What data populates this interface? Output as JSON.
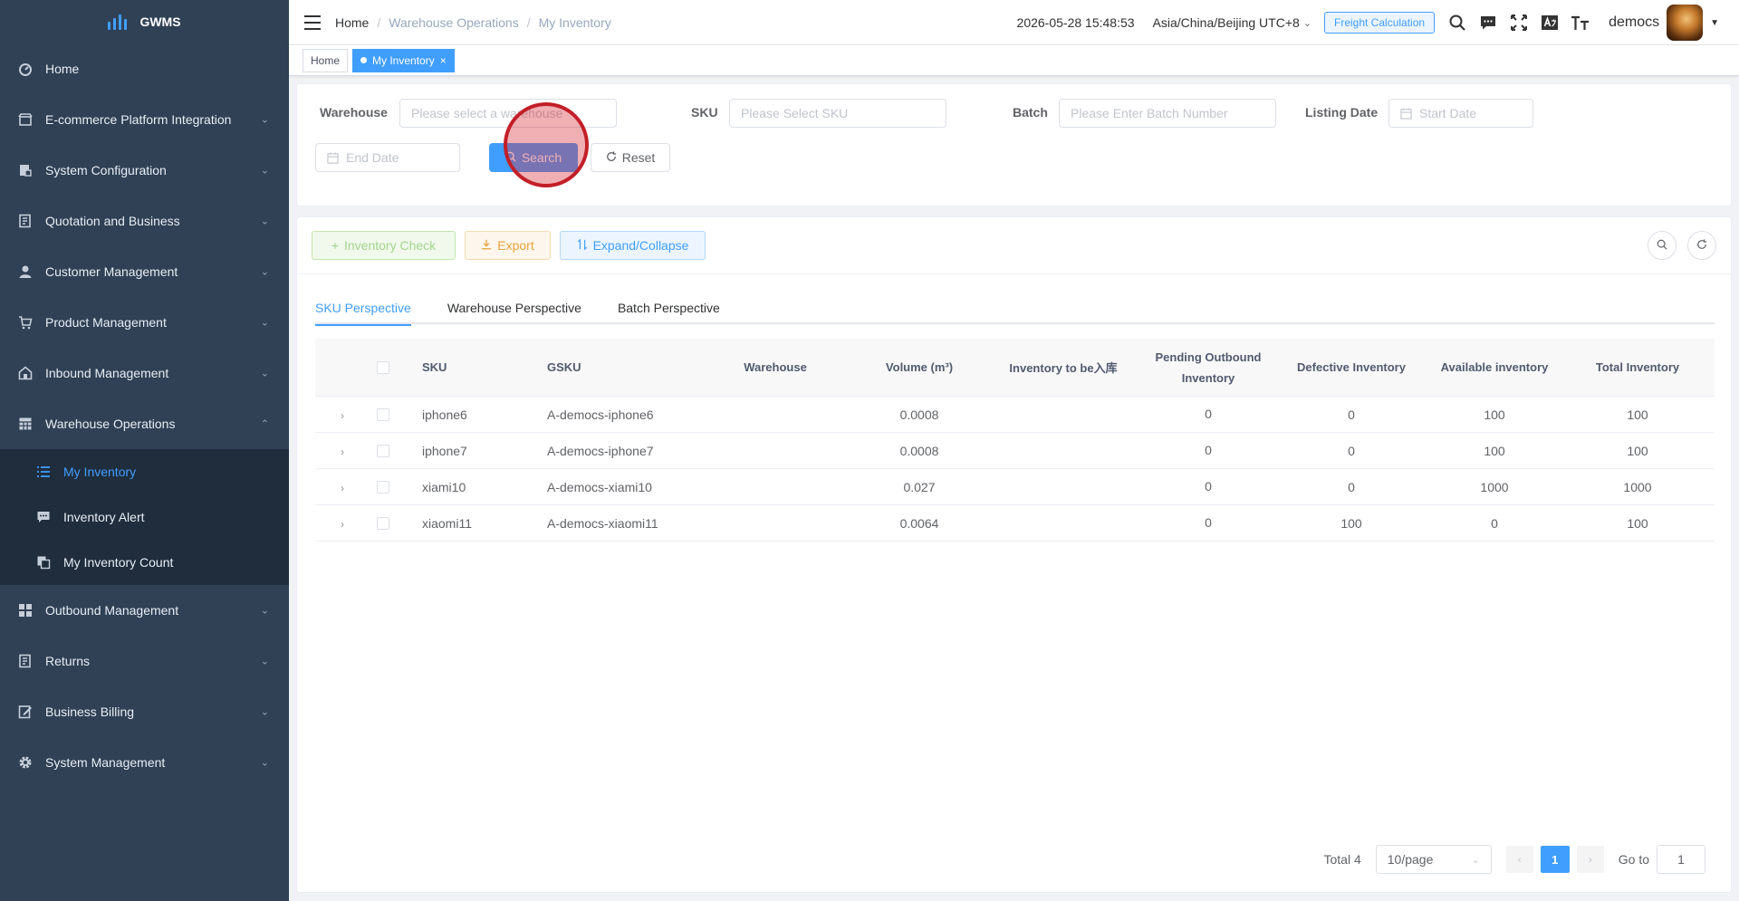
{
  "app": {
    "name": "GWMS"
  },
  "sidebar": {
    "items": [
      {
        "label": "Home",
        "icon": "dashboard-icon"
      },
      {
        "label": "E-commerce Platform Integration",
        "icon": "shop-icon"
      },
      {
        "label": "System Configuration",
        "icon": "config-icon"
      },
      {
        "label": "Quotation and Business",
        "icon": "document-icon"
      },
      {
        "label": "Customer Management",
        "icon": "user-icon"
      },
      {
        "label": "Product Management",
        "icon": "cart-icon"
      },
      {
        "label": "Inbound Management",
        "icon": "warehouse-icon"
      },
      {
        "label": "Warehouse Operations",
        "icon": "table-icon"
      }
    ],
    "sub_items": [
      {
        "label": "My Inventory",
        "icon": "list-icon"
      },
      {
        "label": "Inventory Alert",
        "icon": "message-icon"
      },
      {
        "label": "My Inventory Count",
        "icon": "copy-icon"
      }
    ],
    "items_after": [
      {
        "label": "Outbound Management",
        "icon": "grid-icon"
      },
      {
        "label": "Returns",
        "icon": "return-icon"
      },
      {
        "label": "Business Billing",
        "icon": "edit-icon"
      },
      {
        "label": "System Management",
        "icon": "gear-icon"
      }
    ]
  },
  "navbar": {
    "breadcrumb": [
      "Home",
      "Warehouse Operations",
      "My Inventory"
    ],
    "datetime": "2026-05-28 15:48:53",
    "timezone": "Asia/China/Beijing UTC+8",
    "freight_label": "Freight Calculation",
    "username": "democs"
  },
  "tags": {
    "home": "Home",
    "active": "My Inventory"
  },
  "filters": {
    "warehouse_label": "Warehouse",
    "warehouse_placeholder": "Please select a warehouse",
    "sku_label": "SKU",
    "sku_placeholder": "Please Select SKU",
    "batch_label": "Batch",
    "batch_placeholder": "Please Enter Batch Number",
    "listing_label": "Listing Date",
    "start_placeholder": "Start Date",
    "end_placeholder": "End Date",
    "search_label": "Search",
    "reset_label": "Reset"
  },
  "toolbar": {
    "inventory_check": "Inventory Check",
    "export": "Export",
    "expand_collapse": "Expand/Collapse"
  },
  "tabs": [
    "SKU Perspective",
    "Warehouse Perspective",
    "Batch Perspective"
  ],
  "table": {
    "headers": {
      "sku": "SKU",
      "gsku": "GSKU",
      "warehouse": "Warehouse",
      "volume": "Volume (m³)",
      "to_be_inbound": "Inventory to be入库",
      "pending_outbound": "Pending Outbound Inventory",
      "defective": "Defective Inventory",
      "available": "Available inventory",
      "total": "Total Inventory"
    },
    "rows": [
      {
        "sku": "iphone6",
        "gsku": "A-democs-iphone6",
        "warehouse": "",
        "volume": "0.0008",
        "to_be_inbound": "",
        "pending_outbound": "0",
        "defective": "0",
        "available": "100",
        "total": "100"
      },
      {
        "sku": "iphone7",
        "gsku": "A-democs-iphone7",
        "warehouse": "",
        "volume": "0.0008",
        "to_be_inbound": "",
        "pending_outbound": "0",
        "defective": "0",
        "available": "100",
        "total": "100"
      },
      {
        "sku": "xiami10",
        "gsku": "A-democs-xiami10",
        "warehouse": "",
        "volume": "0.027",
        "to_be_inbound": "",
        "pending_outbound": "0",
        "defective": "0",
        "available": "1000",
        "total": "1000"
      },
      {
        "sku": "xiaomi11",
        "gsku": "A-democs-xiaomi11",
        "warehouse": "",
        "volume": "0.0064",
        "to_be_inbound": "",
        "pending_outbound": "0",
        "defective": "100",
        "available": "0",
        "total": "100"
      }
    ]
  },
  "pagination": {
    "total_label": "Total 4",
    "page_size": "10/page",
    "current_page": "1",
    "goto_label": "Go to",
    "goto_value": "1"
  },
  "colors": {
    "sidebar_bg": "#304156",
    "submenu_bg": "#1f2d3d",
    "accent": "#409eff",
    "success": "#67c23a",
    "warning": "#e6a23c"
  }
}
